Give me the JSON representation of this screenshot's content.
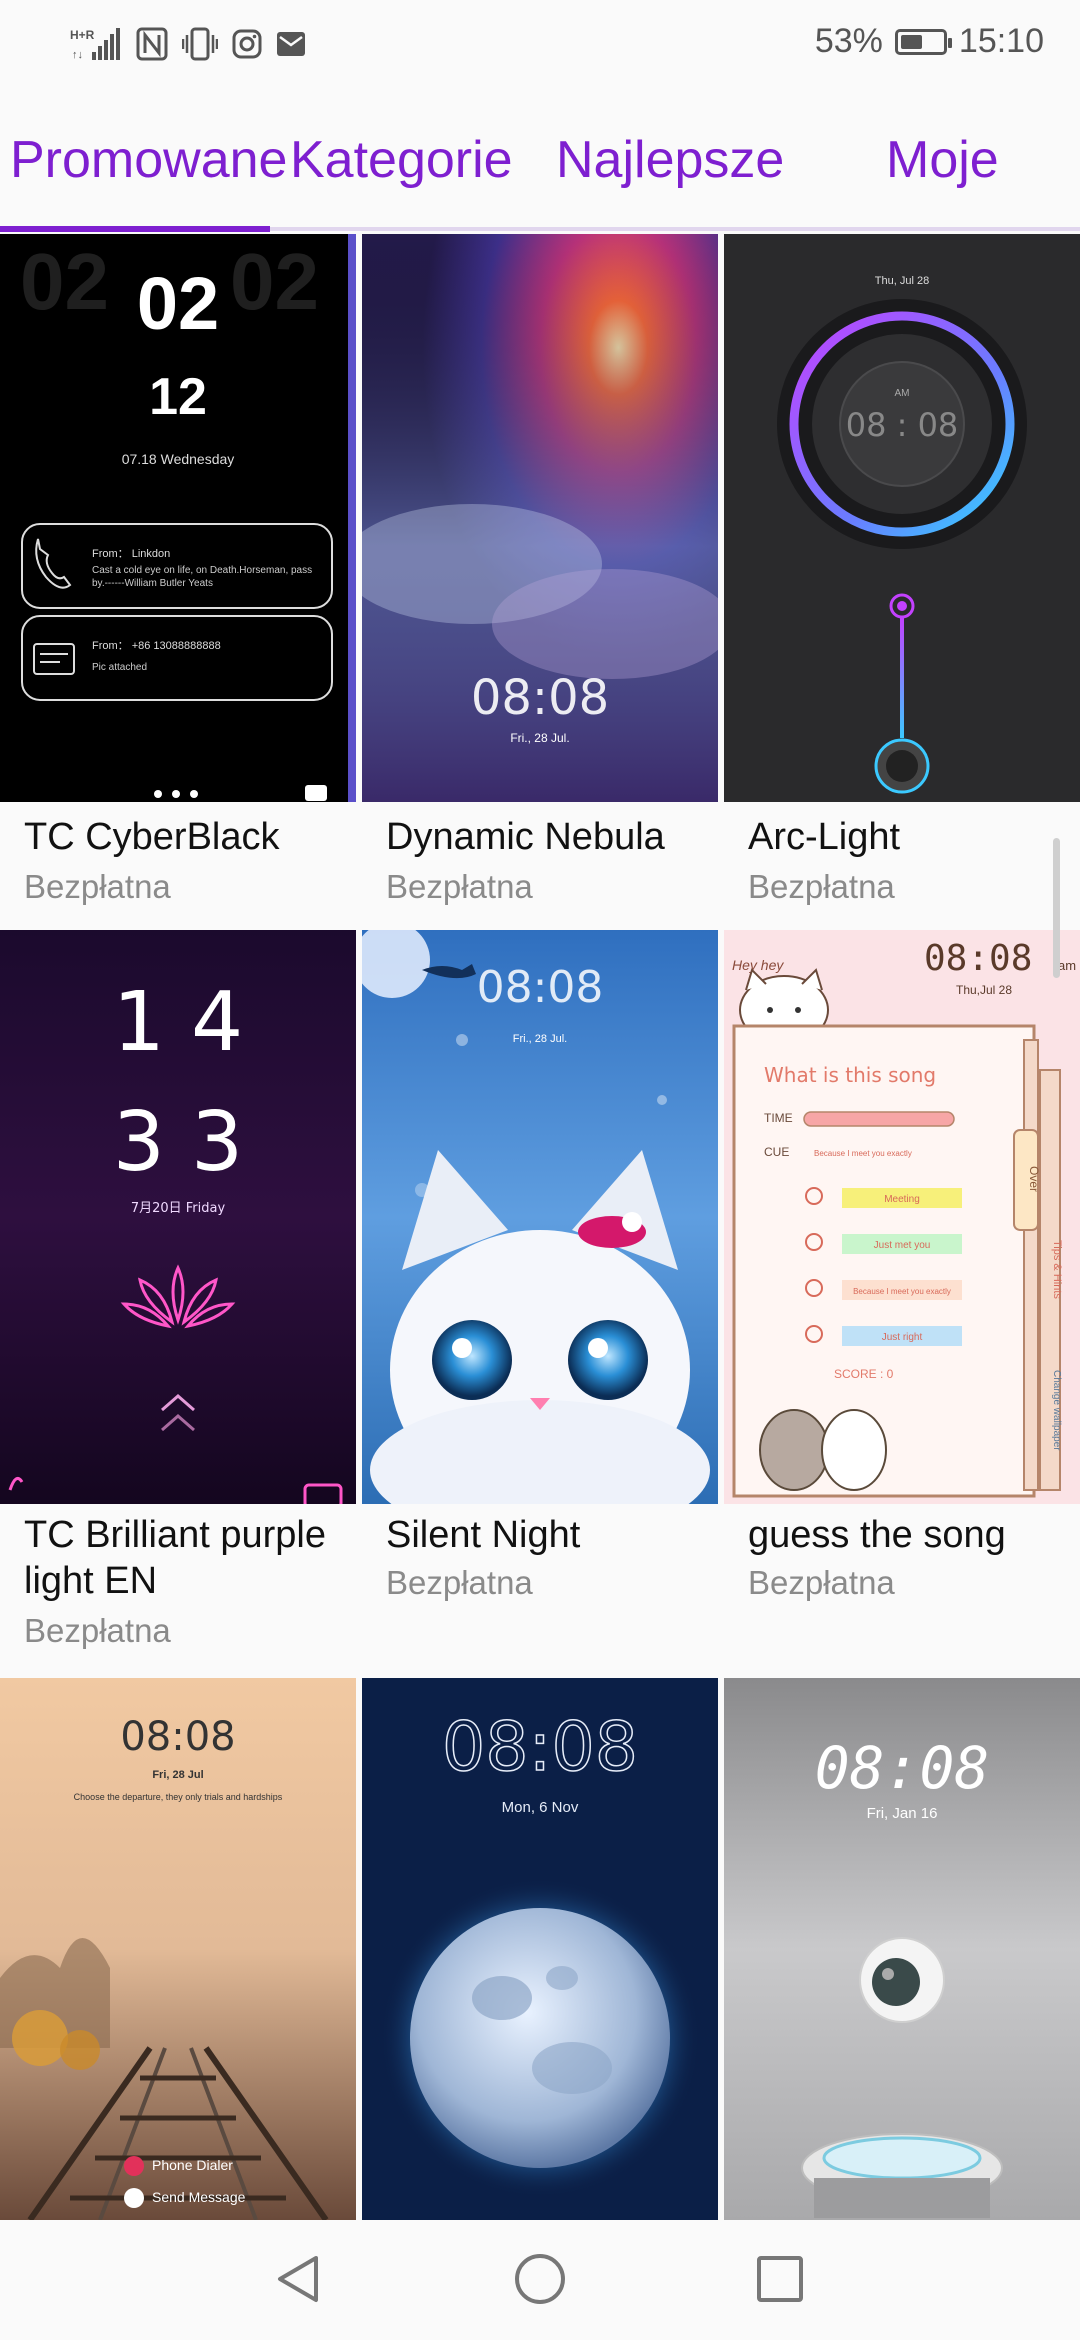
{
  "status_bar": {
    "network": "H+ R",
    "battery_percent": "53%",
    "battery_level": 0.53,
    "time": "15:10",
    "icons": [
      "signal-icon",
      "nfc-icon",
      "vibrate-icon",
      "instagram-icon",
      "mail-icon",
      "battery-icon"
    ]
  },
  "tabs": [
    {
      "label": "Promowane",
      "active": true
    },
    {
      "label": "Kategorie",
      "active": false
    },
    {
      "label": "Najlepsze",
      "active": false
    },
    {
      "label": "Moje",
      "active": false
    }
  ],
  "colors": {
    "accent": "#7e1fd0"
  },
  "themes": [
    {
      "name": "TC CyberBlack",
      "price": "Bezpłatna",
      "preview": {
        "hour": "02",
        "minute": "12",
        "date": "07.18 Wednesday",
        "notifications": [
          {
            "from": "From： Linkdon",
            "text": "Cast a cold eye on life, on Death.Horseman, pass by.------William Butler Yeats"
          },
          {
            "from": "From： +86 13088888888",
            "text": "Pic attached"
          }
        ]
      }
    },
    {
      "name": "Dynamic Nebula",
      "price": "Bezpłatna",
      "preview": {
        "time": "08:08",
        "date": "Fri., 28 Jul."
      }
    },
    {
      "name": "Arc-Light",
      "price": "Bezpłatna",
      "preview": {
        "date": "Thu, Jul 28",
        "ampm": "AM",
        "time": "08 : 08"
      }
    },
    {
      "name": "TC Brilliant purple light EN",
      "price": "Bezpłatna",
      "preview": {
        "hour": "1 4",
        "minute": "3 3",
        "date": "7月20日 Friday"
      }
    },
    {
      "name": "Silent Night",
      "price": "Bezpłatna",
      "preview": {
        "time": "08:08",
        "date": "Fri., 28 Jul."
      }
    },
    {
      "name": "guess the song",
      "price": "Bezpłatna",
      "preview": {
        "greeting": "Hey hey",
        "time": "08:08",
        "ampm": "am",
        "date": "Thu,Jul 28",
        "heading": "What is this song",
        "time_label": "TIME",
        "cue_label": "CUE",
        "cue_text": "Because I meet you exactly",
        "options": [
          "Meeting",
          "Just met you",
          "Because I meet you exactly",
          "Just right"
        ],
        "score": "SCORE : 0",
        "side_tabs": [
          "Over",
          "Tips & Hints",
          "Change wallpaper"
        ]
      }
    },
    {
      "name": "",
      "price": "",
      "preview": {
        "time": "08:08",
        "date": "Fri, 28 Jul",
        "quote": "Choose the departure, they only trials and hardships",
        "actions": [
          "Phone Dialer",
          "Send Message"
        ]
      }
    },
    {
      "name": "",
      "price": "",
      "preview": {
        "time": "08:08",
        "date": "Mon, 6 Nov"
      }
    },
    {
      "name": "",
      "price": "",
      "preview": {
        "time": "08:08",
        "date": "Fri, Jan 16"
      }
    }
  ]
}
